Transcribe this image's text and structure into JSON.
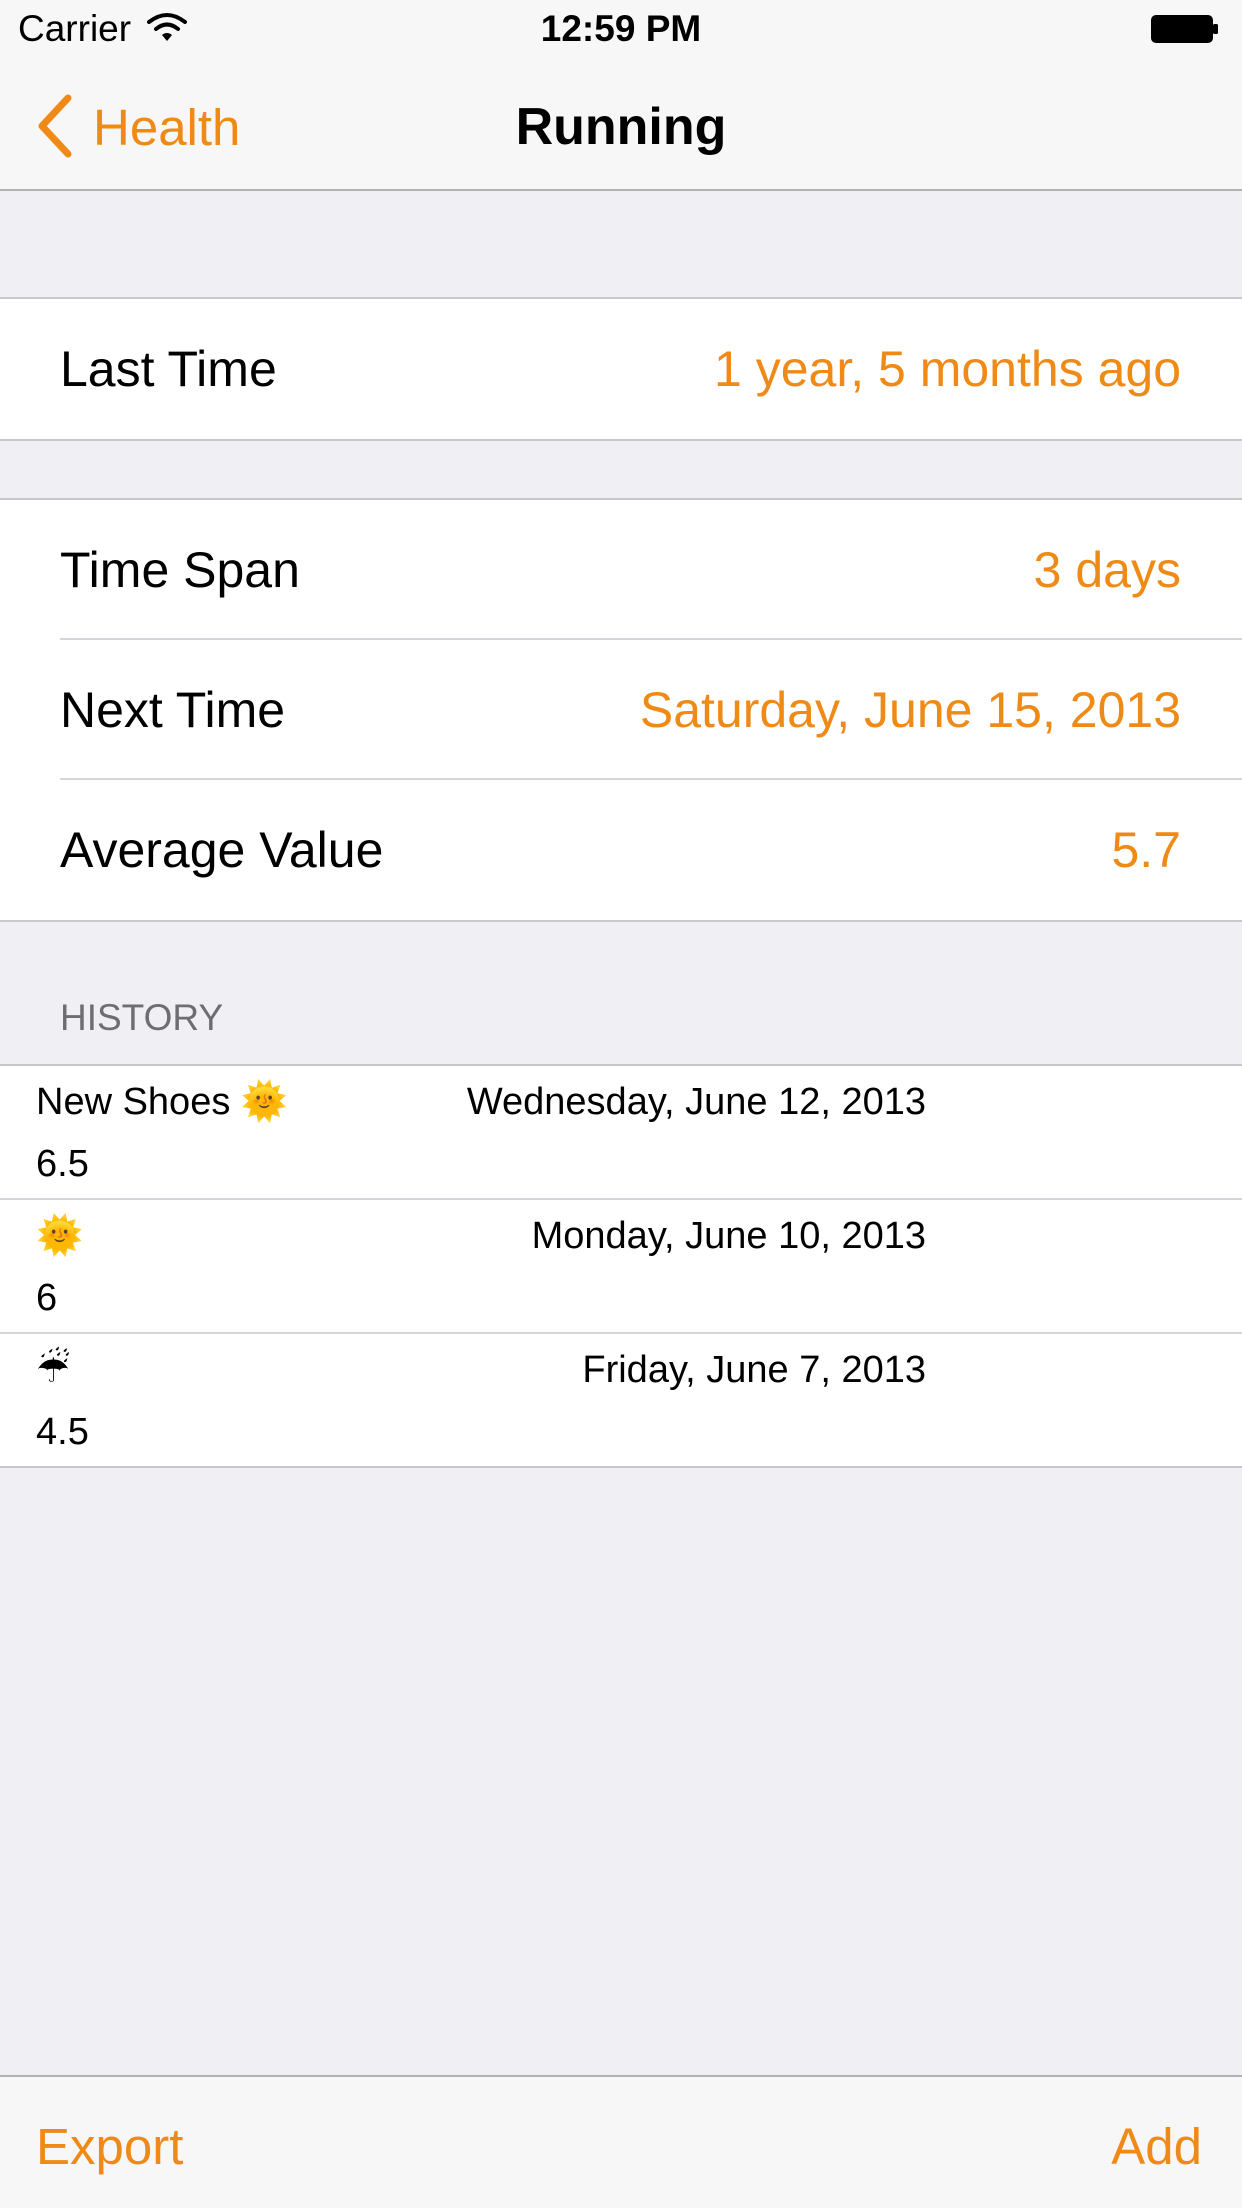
{
  "status_bar": {
    "carrier": "Carrier",
    "time": "12:59 PM"
  },
  "nav": {
    "back_label": "Health",
    "title": "Running"
  },
  "summary": {
    "last_time": {
      "label": "Last Time",
      "value": "1 year, 5 months ago"
    },
    "time_span": {
      "label": "Time Span",
      "value": "3 days"
    },
    "next_time": {
      "label": "Next Time",
      "value": "Saturday, June 15, 2013"
    },
    "average_value": {
      "label": "Average Value",
      "value": "5.7"
    }
  },
  "history": {
    "header": "HISTORY",
    "entries": [
      {
        "note": "New Shoes 🌞",
        "date": "Wednesday, June 12, 2013",
        "value": "6.5"
      },
      {
        "note": "🌞",
        "date": "Monday, June 10, 2013",
        "value": "6"
      },
      {
        "note": "☔",
        "date": "Friday, June 7, 2013",
        "value": "4.5"
      }
    ]
  },
  "toolbar": {
    "export_label": "Export",
    "add_label": "Add"
  },
  "colors": {
    "accent": "#f08a16",
    "background": "#efeff4"
  }
}
